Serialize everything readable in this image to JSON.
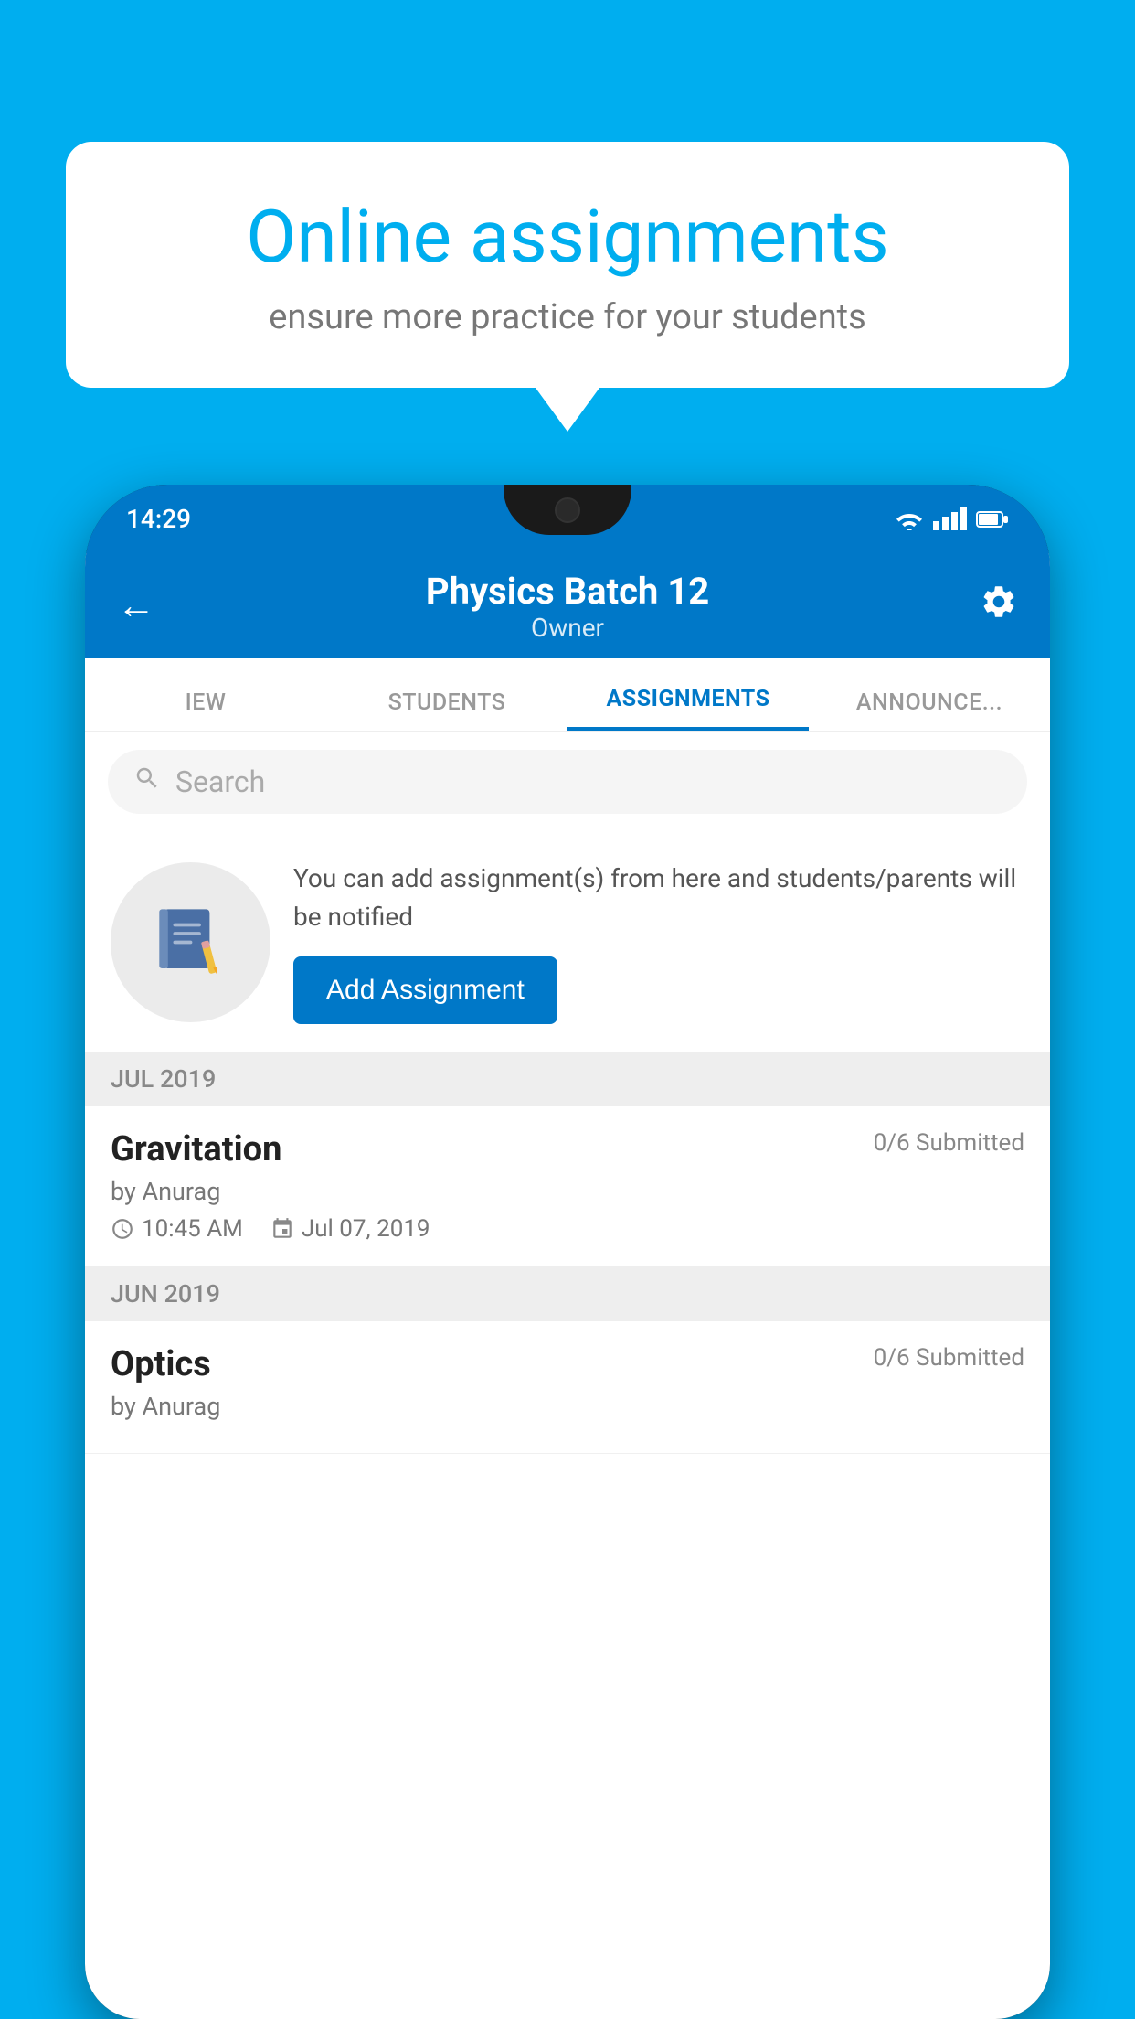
{
  "background_color": "#00AEEF",
  "bubble": {
    "title": "Online assignments",
    "subtitle": "ensure more practice for your students"
  },
  "phone": {
    "status_time": "14:29",
    "header": {
      "title": "Physics Batch 12",
      "subtitle": "Owner",
      "back_label": "←",
      "settings_label": "⚙"
    },
    "tabs": [
      {
        "label": "IEW",
        "active": false
      },
      {
        "label": "STUDENTS",
        "active": false
      },
      {
        "label": "ASSIGNMENTS",
        "active": true
      },
      {
        "label": "ANNOUNCEMENTS",
        "active": false
      }
    ],
    "search": {
      "placeholder": "Search"
    },
    "promo": {
      "text": "You can add assignment(s) from here and students/parents will be notified",
      "button_label": "Add Assignment"
    },
    "sections": [
      {
        "label": "JUL 2019",
        "assignments": [
          {
            "title": "Gravitation",
            "submitted": "0/6 Submitted",
            "author": "by Anurag",
            "time": "10:45 AM",
            "date": "Jul 07, 2019"
          }
        ]
      },
      {
        "label": "JUN 2019",
        "assignments": [
          {
            "title": "Optics",
            "submitted": "0/6 Submitted",
            "author": "by Anurag",
            "time": "",
            "date": ""
          }
        ]
      }
    ]
  }
}
